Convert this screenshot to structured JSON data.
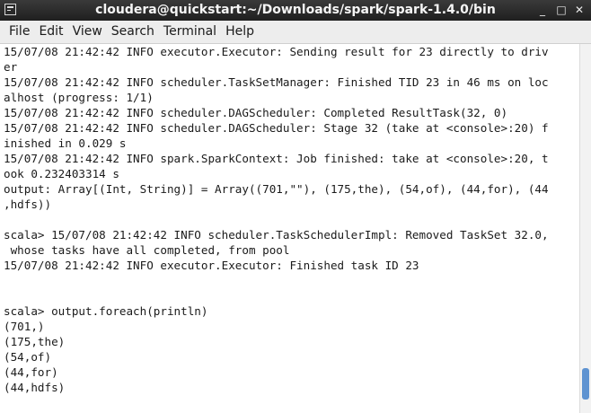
{
  "window": {
    "title": "cloudera@quickstart:~/Downloads/spark/spark-1.4.0/bin",
    "minimize_glyph": "_",
    "maximize_glyph": "□",
    "close_glyph": "✕"
  },
  "menu": {
    "items": [
      "File",
      "Edit",
      "View",
      "Search",
      "Terminal",
      "Help"
    ]
  },
  "terminal": {
    "lines": [
      "15/07/08 21:42:42 INFO executor.Executor: Sending result for 23 directly to driv",
      "er",
      "15/07/08 21:42:42 INFO scheduler.TaskSetManager: Finished TID 23 in 46 ms on loc",
      "alhost (progress: 1/1)",
      "15/07/08 21:42:42 INFO scheduler.DAGScheduler: Completed ResultTask(32, 0)",
      "15/07/08 21:42:42 INFO scheduler.DAGScheduler: Stage 32 (take at <console>:20) f",
      "inished in 0.029 s",
      "15/07/08 21:42:42 INFO spark.SparkContext: Job finished: take at <console>:20, t",
      "ook 0.232403314 s",
      "output: Array[(Int, String)] = Array((701,\"\"), (175,the), (54,of), (44,for), (44",
      ",hdfs))",
      "",
      "scala> 15/07/08 21:42:42 INFO scheduler.TaskSchedulerImpl: Removed TaskSet 32.0,",
      " whose tasks have all completed, from pool",
      "15/07/08 21:42:42 INFO executor.Executor: Finished task ID 23",
      "",
      "",
      "scala> output.foreach(println)",
      "(701,)",
      "(175,the)",
      "(54,of)",
      "(44,for)",
      "(44,hdfs)"
    ]
  },
  "colors": {
    "titlebar": "#2b2b2b",
    "menubar": "#ededed",
    "scroll_thumb": "#5e93d1"
  }
}
